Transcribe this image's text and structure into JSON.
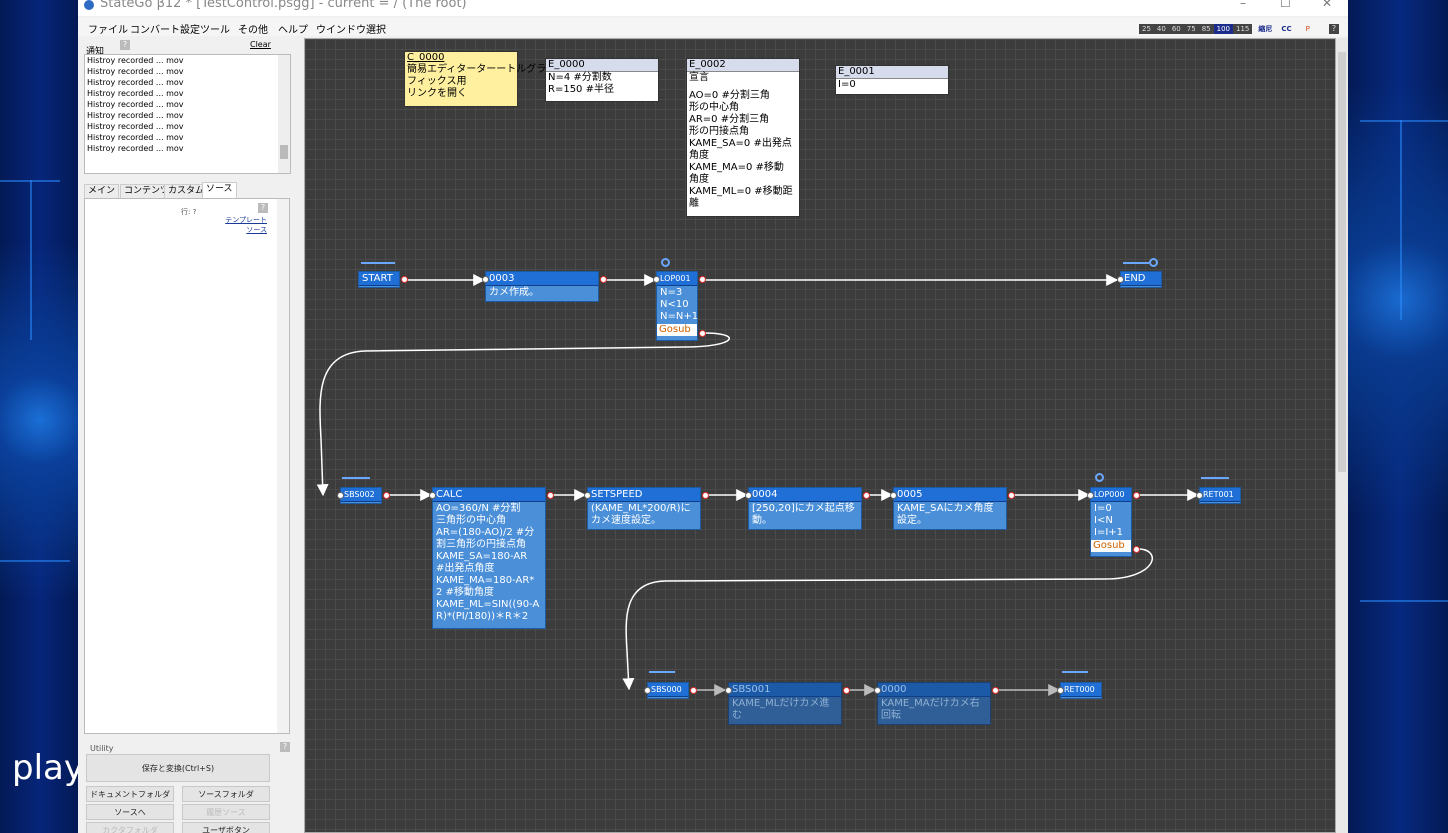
{
  "overlay": {
    "play_label": "play"
  },
  "titlebar": {
    "title": "StateGo β12 *  [TestControl.psgg] - current = / (The root)",
    "min": "–",
    "max": "☐",
    "close": "✕"
  },
  "menu": [
    "ファイル",
    "コンバート設定",
    "ツール",
    "その他",
    "ヘルプ",
    "ウインドウ選択"
  ],
  "zoom": {
    "levels": [
      "25",
      "40",
      "60",
      "75",
      "85",
      "100",
      "115"
    ],
    "selected": "100",
    "extra1": "縮尼",
    "extra2": "CC",
    "extra3": "P",
    "help": "?"
  },
  "notice": {
    "label": "通知",
    "help": "?",
    "clear": "Clear",
    "items": [
      "Histroy recorded ... mov",
      "Histroy recorded ... mov",
      "Histroy recorded ... mov",
      "Histroy recorded ... mov",
      "Histroy recorded ... mov",
      "Histroy recorded ... mov",
      "Histroy recorded ... mov",
      "Histroy recorded ... mov",
      "Histroy recorded ... mov"
    ]
  },
  "tabs": [
    "メイン",
    "コンテンツ",
    "カスタム",
    "ソース"
  ],
  "source": {
    "row_label": "行: ?",
    "help": "?",
    "template_link": "テンプレート",
    "source_link": "ソース"
  },
  "utility": {
    "label": "Utility",
    "help": "?",
    "save_convert": "保存と変換(Ctrl+S)",
    "doc_folder": "ドキュメントフォルダ",
    "source_folder": "ソースフォルダ",
    "to_source": "ソースへ",
    "disabled1": "履歴ソース",
    "disabled2": "カクタフォルダ",
    "user_button": "ユーザボタン"
  },
  "notes": {
    "c0000": {
      "title": "C_0000",
      "lines": [
        "簡易エディターターートルグラ",
        "フィックス用",
        "リンクを開く"
      ]
    },
    "e0000": {
      "title": "E_0000",
      "lines": [
        "N=4          #分割数",
        "R=150        #半径"
      ]
    },
    "e0002": {
      "title": "E_0002",
      "lines": [
        "宣言",
        "",
        "AO=0     #分割三角",
        "形の中心角",
        "AR=0     #分割三角",
        "形の円接点角",
        "KAME_SA=0 #出発点",
        "角度",
        "KAME_MA=0 #移動",
        "角度",
        "KAME_ML=0 #移動距",
        "離"
      ]
    },
    "e0001": {
      "title": "E_0001",
      "lines": [
        "I=0"
      ]
    }
  },
  "nodes": {
    "start": {
      "title": "START"
    },
    "n0003": {
      "title": "0003",
      "lines": [
        "カメ作成。"
      ]
    },
    "lop001": {
      "title": "LOP001",
      "lines": [
        "N=3",
        "N<10",
        "N=N+1"
      ],
      "gosub": "Gosub"
    },
    "end": {
      "title": "END"
    },
    "sbs002": {
      "title": "SBS002"
    },
    "calc": {
      "title": "CALC",
      "lines": [
        "AO=360/N      #分割",
        "三角形の中心角",
        "AR=(180-AO)/2 #分",
        "割三角形の円接点角",
        "KAME_SA=180-AR",
        "#出発点角度",
        "KAME_MA=180-AR*",
        "2 #移動角度",
        "KAME_ML=SIN((90-A",
        "R)*(PI/180))＊R＊2"
      ]
    },
    "setspeed": {
      "title": "SETSPEED",
      "lines": [
        "(KAME_ML*200/R)に",
        "カメ速度設定。"
      ]
    },
    "n0004": {
      "title": "0004",
      "lines": [
        "[250,20]にカメ起点移",
        "動。"
      ]
    },
    "n0005": {
      "title": "0005",
      "lines": [
        "KAME_SAにカメ角度",
        "設定。"
      ]
    },
    "lop000": {
      "title": "LOP000",
      "lines": [
        "I=0",
        "I<N",
        "I=I+1"
      ],
      "gosub": "Gosub"
    },
    "ret001": {
      "title": "RET001"
    },
    "sbs000": {
      "title": "SBS000"
    },
    "sbs001": {
      "title": "SBS001",
      "lines": [
        "KAME_MLだけカメ進",
        "む"
      ]
    },
    "n0000": {
      "title": "0000",
      "lines": [
        "KAME_MAだけカメ右",
        "回転"
      ]
    },
    "ret000": {
      "title": "RET000"
    }
  }
}
